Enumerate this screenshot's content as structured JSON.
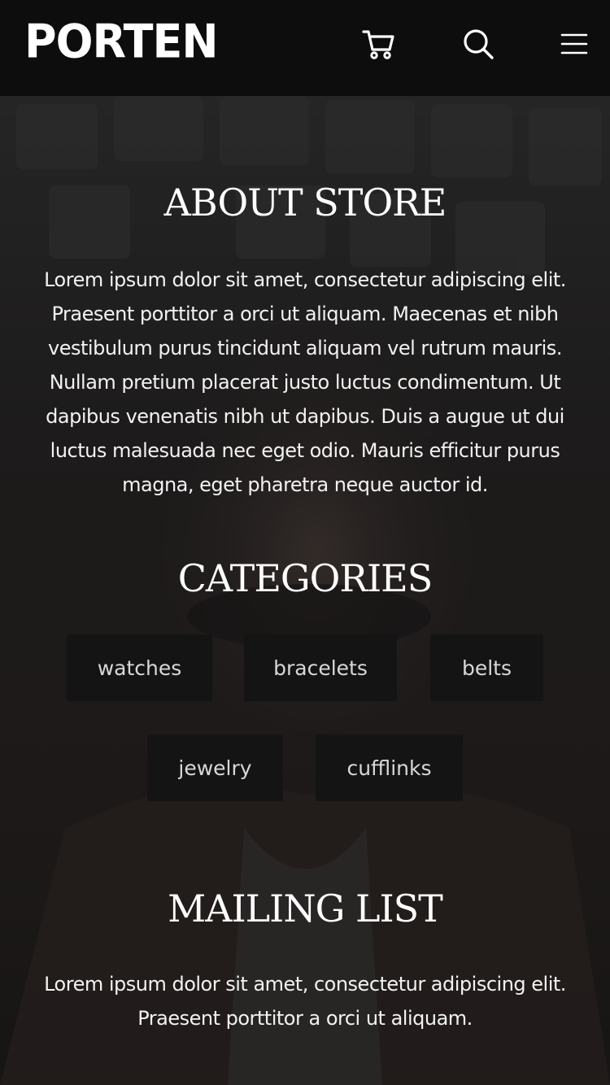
{
  "header": {
    "logo": "PORTEN",
    "icons": [
      "cart-icon",
      "search-icon",
      "menu-icon"
    ]
  },
  "about": {
    "title": "ABOUT STORE",
    "text": "Lorem ipsum dolor sit amet, consectetur adipiscing elit. Praesent porttitor a orci ut aliquam. Maecenas et nibh vestibulum purus tincidunt aliquam vel rutrum mauris. Nullam pretium placerat justo luctus condimentum. Ut dapibus venenatis nibh ut dapibus. Duis a augue ut dui luctus malesuada nec eget odio. Mauris efficitur purus magna, eget pharetra neque auctor id."
  },
  "categories": {
    "title": "CATEGORIES",
    "items": [
      "watches",
      "bracelets",
      "belts",
      "jewelry",
      "cufflinks"
    ]
  },
  "mailing": {
    "title": "MAILING LIST",
    "text": "Lorem ipsum dolor sit amet, consectetur adipiscing elit. Praesent porttitor a orci ut aliquam."
  },
  "colors": {
    "header_bg": "#0d0d0d",
    "button_bg": "#141414",
    "text": "#ffffff"
  }
}
